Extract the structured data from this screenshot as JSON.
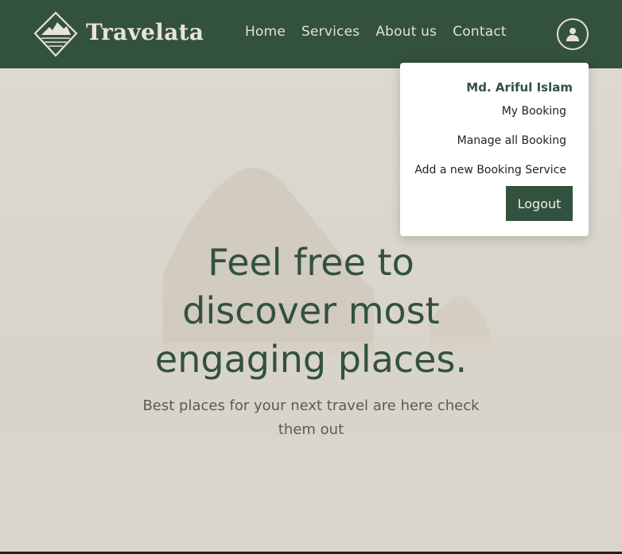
{
  "brand": {
    "name": "Travelata"
  },
  "nav": {
    "items": [
      "Home",
      "Services",
      "About us",
      "Contact"
    ]
  },
  "user_menu": {
    "name": "Md. Ariful Islam",
    "items": [
      "My Booking",
      "Manage all Booking",
      "Add a new Booking Service"
    ],
    "logout_label": "Logout"
  },
  "hero": {
    "headline_lines": [
      "Feel free to",
      "discover most",
      "engaging places."
    ],
    "subtext": "Best places for your next travel are here check them out"
  },
  "colors": {
    "primary": "#33513f",
    "hero_bg": "#ddd9d0",
    "nav_text": "#e6e0d3"
  }
}
